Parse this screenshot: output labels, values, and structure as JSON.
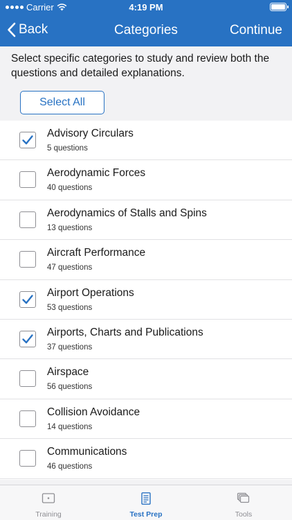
{
  "status": {
    "carrier": "Carrier",
    "time": "4:19 PM"
  },
  "nav": {
    "back_label": "Back",
    "title": "Categories",
    "continue_label": "Continue"
  },
  "intro_text": "Select specific categories to study and review both the questions and detailed explanations.",
  "select_all_label": "Select All",
  "categories": [
    {
      "name": "Advisory Circulars",
      "count": "5 questions",
      "checked": true
    },
    {
      "name": "Aerodynamic Forces",
      "count": "40 questions",
      "checked": false
    },
    {
      "name": "Aerodynamics of Stalls and Spins",
      "count": "13 questions",
      "checked": false
    },
    {
      "name": "Aircraft Performance",
      "count": "47 questions",
      "checked": false
    },
    {
      "name": "Airport Operations",
      "count": "53 questions",
      "checked": true
    },
    {
      "name": "Airports, Charts and Publications",
      "count": "37 questions",
      "checked": true
    },
    {
      "name": "Airspace",
      "count": "56 questions",
      "checked": false
    },
    {
      "name": "Collision Avoidance",
      "count": "14 questions",
      "checked": false
    },
    {
      "name": "Communications",
      "count": "46 questions",
      "checked": false
    }
  ],
  "tabs": [
    {
      "label": "Training",
      "icon": "training-icon",
      "active": false
    },
    {
      "label": "Test Prep",
      "icon": "test-prep-icon",
      "active": true
    },
    {
      "label": "Tools",
      "icon": "tools-icon",
      "active": false
    }
  ],
  "colors": {
    "accent": "#2872c3",
    "inactive": "#8e8e93"
  }
}
